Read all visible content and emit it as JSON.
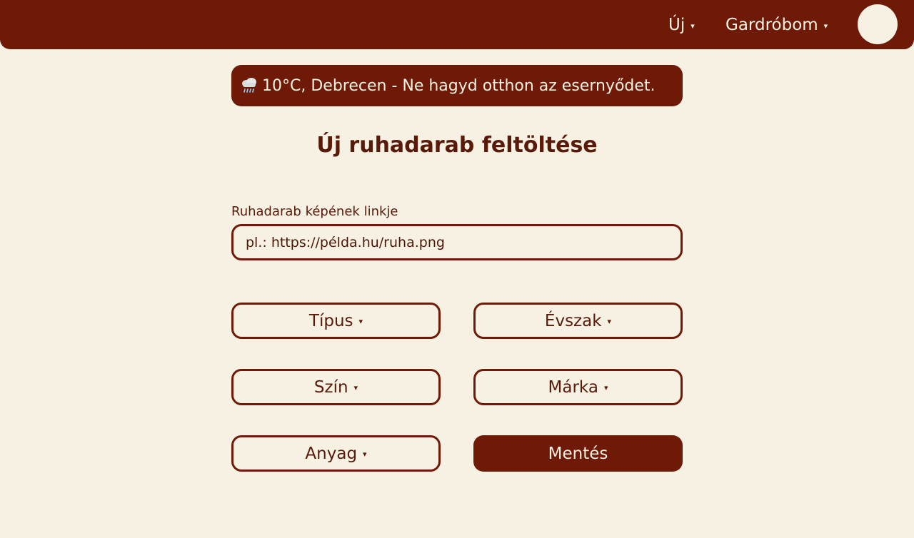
{
  "nav": {
    "new_label": "Új",
    "wardrobe_label": "Gardróbom",
    "caret": "▾"
  },
  "weather": {
    "icon": "rain-cloud-icon",
    "text": "10°C, Debrecen - Ne hagyd otthon az esernyődet."
  },
  "form": {
    "title": "Új ruhadarab feltöltése",
    "image_link_label": "Ruhadarab képének linkje",
    "image_link_placeholder": "pl.: https://példa.hu/ruha.png",
    "image_link_value": "",
    "type_label": "Típus",
    "season_label": "Évszak",
    "color_label": "Szín",
    "brand_label": "Márka",
    "material_label": "Anyag",
    "save_label": "Mentés"
  },
  "colors": {
    "primary": "#6e1a06",
    "background": "#f6f1e2",
    "text": "#5a1a0a"
  }
}
